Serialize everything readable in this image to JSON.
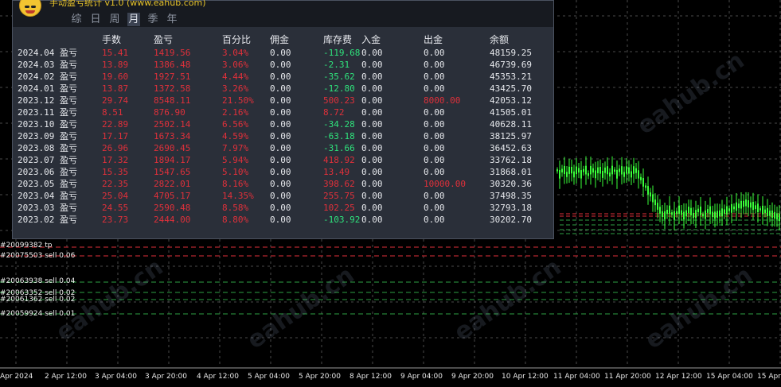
{
  "panel": {
    "title": "手动盈亏统计 v1.0   (www.eahub.com)",
    "tabs": [
      {
        "label": "综",
        "active": false
      },
      {
        "label": "日",
        "active": false
      },
      {
        "label": "周",
        "active": false
      },
      {
        "label": "月",
        "active": true
      },
      {
        "label": "季",
        "active": false
      },
      {
        "label": "年",
        "active": false
      }
    ],
    "columns": [
      "",
      "手数",
      "盈亏",
      "百分比",
      "佣金",
      "库存费",
      "入金",
      "出金",
      "余额"
    ],
    "rows": [
      {
        "date": "2024.04 盈亏",
        "lots": "15.41",
        "pl": "1419.56",
        "pct": "3.04%",
        "comm": "0.00",
        "swap": "-119.68",
        "dep": "0.00",
        "wd": "0.00",
        "bal": "48159.25"
      },
      {
        "date": "2024.03 盈亏",
        "lots": "13.89",
        "pl": "1386.48",
        "pct": "3.06%",
        "comm": "0.00",
        "swap": "-2.31",
        "dep": "0.00",
        "wd": "0.00",
        "bal": "46739.69"
      },
      {
        "date": "2024.02 盈亏",
        "lots": "19.60",
        "pl": "1927.51",
        "pct": "4.44%",
        "comm": "0.00",
        "swap": "-35.62",
        "dep": "0.00",
        "wd": "0.00",
        "bal": "45353.21"
      },
      {
        "date": "2024.01 盈亏",
        "lots": "13.87",
        "pl": "1372.58",
        "pct": "3.26%",
        "comm": "0.00",
        "swap": "-12.80",
        "dep": "0.00",
        "wd": "0.00",
        "bal": "43425.70"
      },
      {
        "date": "2023.12 盈亏",
        "lots": "29.74",
        "pl": "8548.11",
        "pct": "21.50%",
        "comm": "0.00",
        "swap": "500.23",
        "dep": "0.00",
        "wd": "8000.00",
        "bal": "42053.12"
      },
      {
        "date": "2023.11 盈亏",
        "lots": "8.51",
        "pl": "876.90",
        "pct": "2.16%",
        "comm": "0.00",
        "swap": "8.72",
        "dep": "0.00",
        "wd": "0.00",
        "bal": "41505.01"
      },
      {
        "date": "2023.10 盈亏",
        "lots": "22.89",
        "pl": "2502.14",
        "pct": "6.56%",
        "comm": "0.00",
        "swap": "-34.28",
        "dep": "0.00",
        "wd": "0.00",
        "bal": "40628.11"
      },
      {
        "date": "2023.09 盈亏",
        "lots": "17.17",
        "pl": "1673.34",
        "pct": "4.59%",
        "comm": "0.00",
        "swap": "-63.18",
        "dep": "0.00",
        "wd": "0.00",
        "bal": "38125.97"
      },
      {
        "date": "2023.08 盈亏",
        "lots": "26.96",
        "pl": "2690.45",
        "pct": "7.97%",
        "comm": "0.00",
        "swap": "-31.66",
        "dep": "0.00",
        "wd": "0.00",
        "bal": "36452.63"
      },
      {
        "date": "2023.07 盈亏",
        "lots": "17.32",
        "pl": "1894.17",
        "pct": "5.94%",
        "comm": "0.00",
        "swap": "418.92",
        "dep": "0.00",
        "wd": "0.00",
        "bal": "33762.18"
      },
      {
        "date": "2023.06 盈亏",
        "lots": "15.35",
        "pl": "1547.65",
        "pct": "5.10%",
        "comm": "0.00",
        "swap": "13.49",
        "dep": "0.00",
        "wd": "0.00",
        "bal": "31868.01"
      },
      {
        "date": "2023.05 盈亏",
        "lots": "22.35",
        "pl": "2822.01",
        "pct": "8.16%",
        "comm": "0.00",
        "swap": "398.62",
        "dep": "0.00",
        "wd": "10000.00",
        "bal": "30320.36"
      },
      {
        "date": "2023.04 盈亏",
        "lots": "25.04",
        "pl": "4705.17",
        "pct": "14.35%",
        "comm": "0.00",
        "swap": "255.75",
        "dep": "0.00",
        "wd": "0.00",
        "bal": "37498.35"
      },
      {
        "date": "2023.03 盈亏",
        "lots": "24.55",
        "pl": "2590.48",
        "pct": "8.58%",
        "comm": "0.00",
        "swap": "102.25",
        "dep": "0.00",
        "wd": "0.00",
        "bal": "32793.18"
      },
      {
        "date": "2023.02 盈亏",
        "lots": "23.73",
        "pl": "2444.00",
        "pct": "8.80%",
        "comm": "0.00",
        "swap": "-103.92",
        "dep": "0.00",
        "wd": "0.00",
        "bal": "30202.70"
      }
    ]
  },
  "orders": [
    "#20099382 tp",
    "#20075503 sell 0.06",
    "#20063938 sell 0.04",
    "#20063352 sell 0.02",
    "#20061362 sell 0.02",
    "#20059924 sell 0.01"
  ],
  "time_axis": [
    "Apr 2024",
    "2 Apr 12:00",
    "3 Apr 04:00",
    "3 Apr 20:00",
    "4 Apr 12:00",
    "5 Apr 04:00",
    "5 Apr 20:00",
    "8 Apr 12:00",
    "9 Apr 04:00",
    "9 Apr 20:00",
    "10 Apr 12:00",
    "11 Apr 04:00",
    "11 Apr 20:00",
    "12 Apr 12:00",
    "15 Apr 04:00",
    "15 Apr"
  ],
  "watermark": "eahub.cn",
  "colors": {
    "candle": "#3aff3a",
    "loss": "#e0303a",
    "profit": "#2fe37c",
    "order_line": "#2ea043",
    "tp_line": "#e0303a"
  }
}
